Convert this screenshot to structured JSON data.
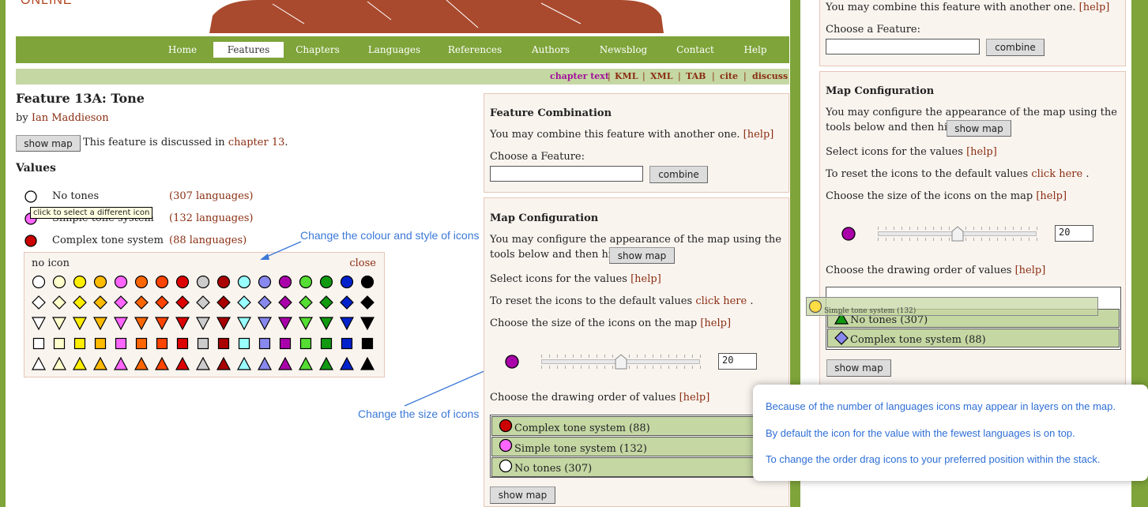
{
  "header": {
    "logo_text": "ONLINE"
  },
  "nav": {
    "items": [
      "Home",
      "Features",
      "Chapters",
      "Languages",
      "References",
      "Authors",
      "Newsblog",
      "Contact",
      "Help"
    ],
    "active": "Features"
  },
  "subnav": {
    "items": [
      "chapter text",
      "KML",
      "XML",
      "TAB",
      "cite",
      "discuss"
    ]
  },
  "feature": {
    "title": "Feature 13A: Tone",
    "by_prefix": "by",
    "author": "Ian Maddieson",
    "show_map": "show map",
    "discussed_text": "This feature is discussed in",
    "chapter_link": "chapter 13",
    "period": "."
  },
  "values": {
    "heading": "Values",
    "items": [
      {
        "label": "No tones",
        "count": "(307 languages)",
        "color": "#ffffff"
      },
      {
        "label": "Simple tone system",
        "count": "(132 languages)",
        "color": "#ff66ff"
      },
      {
        "label": "Complex tone system",
        "count": "(88 languages)",
        "color": "#cc0000"
      }
    ],
    "tooltip": "click to select a different icon"
  },
  "picker": {
    "no_icon": "no icon",
    "close": "close",
    "colors": [
      "#ffffff",
      "#ffffcc",
      "#ffee00",
      "#ffbb00",
      "#ff66ff",
      "#ff6600",
      "#ff4400",
      "#dd0000",
      "#cccccc",
      "#aa0000",
      "#99ffff",
      "#8888ee",
      "#aa00aa",
      "#55dd33",
      "#119911",
      "#0022cc",
      "#000000"
    ],
    "shapes": [
      "circle",
      "diamond",
      "triangle-down",
      "square",
      "triangle-up"
    ]
  },
  "callouts": {
    "colour_style": "Change the colour and style of icons",
    "size": "Change the size of icons"
  },
  "combination": {
    "heading": "Feature Combination",
    "text": "You may combine this feature with another one.",
    "help": "[help]",
    "choose_label": "Choose a Feature:",
    "input_value": "",
    "combine": "combine"
  },
  "map_config": {
    "heading": "Map Configuration",
    "text_line1": "You may configure the appearance of the map using the",
    "text_line2": "tools below and then hit",
    "show_map": "show map",
    "select_icons": "Select icons for the values",
    "reset_text": "To reset the icons to the default values",
    "click_here": "click here",
    "period": ".",
    "size_text": "Choose the size of the icons on the map",
    "size_value": "20",
    "size_fraction": 0.5,
    "order_text": "Choose the drawing order of values",
    "help": "[help]",
    "order": [
      {
        "label": "Complex tone system (88)",
        "color": "#cc0000"
      },
      {
        "label": "Simple tone system (132)",
        "color": "#ff66ff"
      },
      {
        "label": "No tones (307)",
        "color": "#ffffff"
      }
    ],
    "show_map_bottom": "show map"
  },
  "right_panel": {
    "combine_text": "You may combine this feature with another one.",
    "help": "[help]",
    "choose_label": "Choose a Feature:",
    "combine": "combine",
    "heading": "Map Configuration",
    "text_line1": "You may configure the appearance of the map using the",
    "text_line2": "tools below and then hit",
    "show_map": "show map",
    "select_icons": "Select icons for the values",
    "reset_text": "To reset the icons to the default values",
    "click_here": "click here",
    "period": ".",
    "size_text": "Choose the size of the icons on the map",
    "size_value": "20",
    "order_text": "Choose the drawing order of values",
    "dragging": {
      "label": "Simple tone system (132)",
      "color": "#ffdd44"
    },
    "order": [
      {
        "label": "No tones (307)",
        "color": "#119911",
        "shape": "triangle-up"
      },
      {
        "label": "Complex tone system (88)",
        "color": "#8888ee",
        "shape": "diamond"
      }
    ],
    "show_map_bottom": "show map"
  },
  "tip": {
    "lines": [
      "Because of the number of languages icons may appear in layers on the map.",
      "By default the icon for the value with the fewest languages is on top.",
      "To change the order drag icons to your preferred position within the stack."
    ]
  },
  "colors": {
    "accent_green": "#7ea43a",
    "link": "#8a2e12",
    "callout_blue": "#3b78d8"
  }
}
